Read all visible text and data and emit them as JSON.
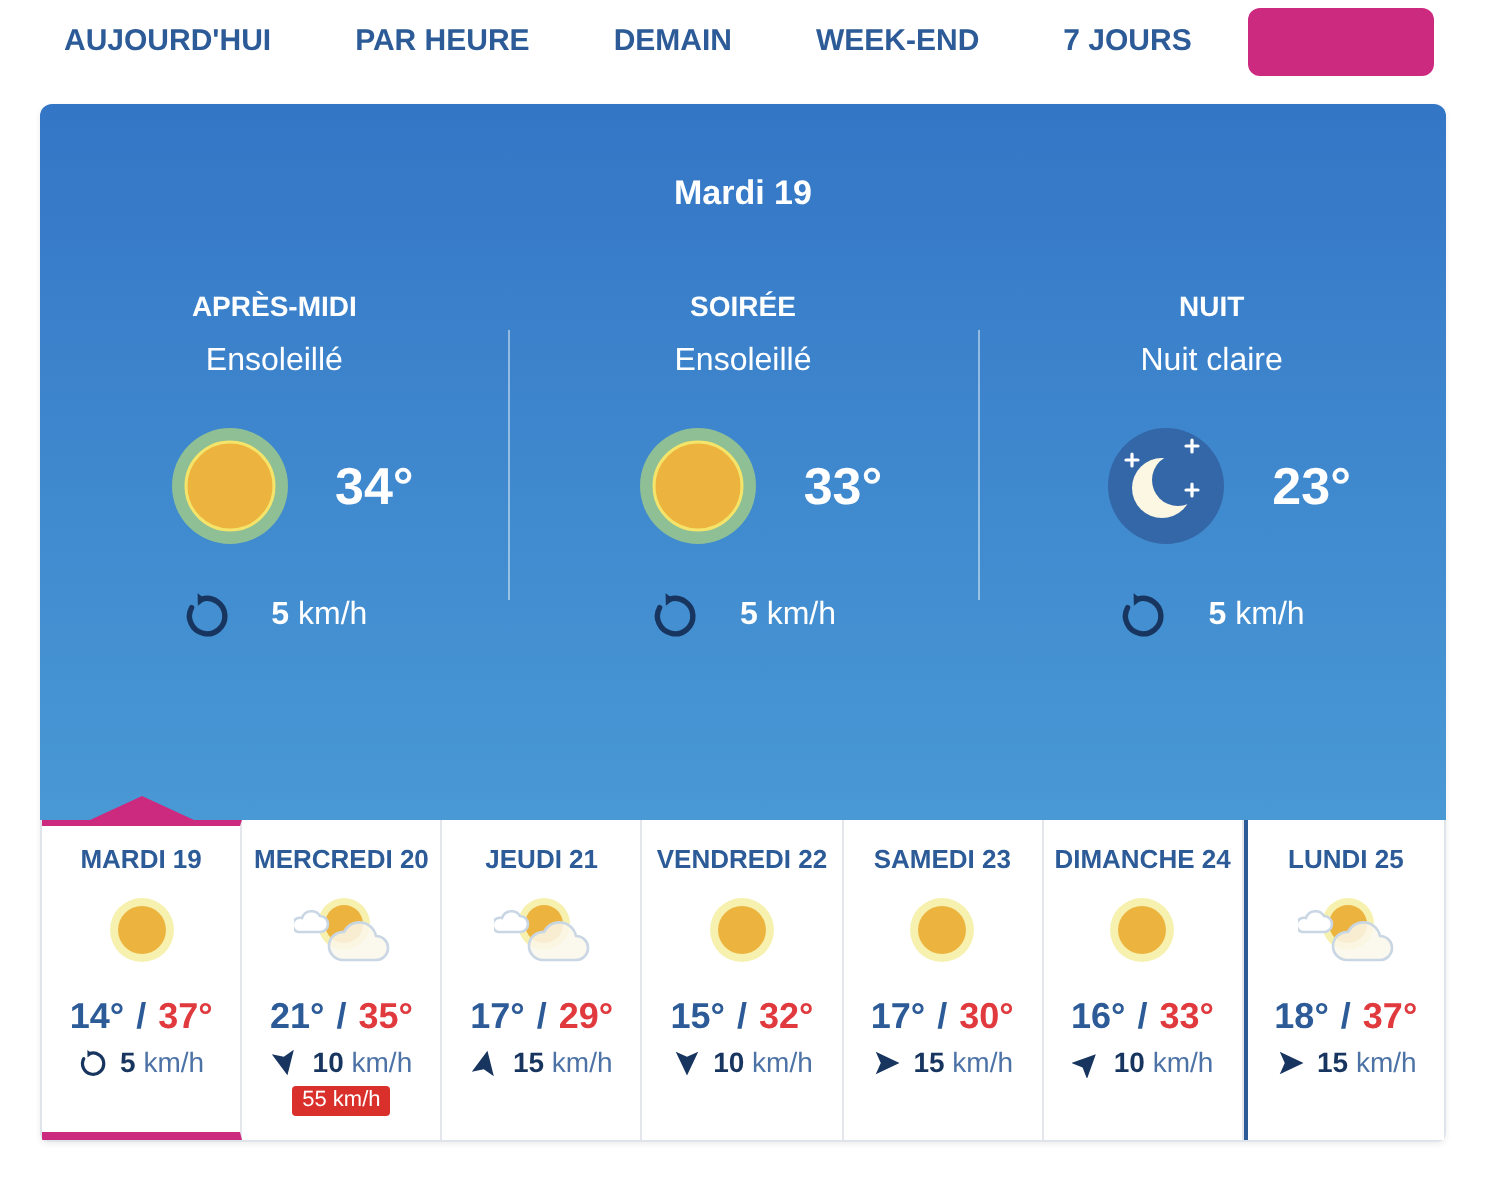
{
  "nav": {
    "tabs": [
      {
        "label": "AUJOURD'HUI"
      },
      {
        "label": "PAR HEURE"
      },
      {
        "label": "DEMAIN"
      },
      {
        "label": "WEEK-END"
      },
      {
        "label": "7 JOURS"
      }
    ]
  },
  "forecast": {
    "title": "Mardi 19",
    "periods": [
      {
        "name": "APRÈS-MIDI",
        "condition": "Ensoleillé",
        "kind": "sun",
        "temperature": "34°",
        "wind": {
          "kind": "variable",
          "text": "**5** km/h"
        }
      },
      {
        "name": "SOIRÉE",
        "condition": "Ensoleillé",
        "kind": "sun",
        "temperature": "33°",
        "wind": {
          "kind": "variable",
          "text": "**5** km/h"
        }
      },
      {
        "name": "NUIT",
        "condition": "Nuit claire",
        "kind": "moon",
        "temperature": "23°",
        "wind": {
          "kind": "variable",
          "text": "**5** km/h"
        }
      }
    ]
  },
  "days": [
    {
      "label": "MARDI 19",
      "selected": true,
      "week_boundary": false,
      "kind": "sun",
      "min": "14°",
      "separator": "/",
      "max": "37°",
      "wind": {
        "kind": "variable",
        "text": "**5** km/h"
      }
    },
    {
      "label": "MERCREDI 20",
      "selected": false,
      "week_boundary": false,
      "kind": "suncloud",
      "min": "21°",
      "separator": "/",
      "max": "35°",
      "wind": {
        "kind": "sbe",
        "text": "**10** km/h"
      },
      "gust": "55 km/h"
    },
    {
      "label": "JEUDI 21",
      "selected": false,
      "week_boundary": false,
      "kind": "suncloud",
      "min": "17°",
      "separator": "/",
      "max": "29°",
      "wind": {
        "kind": "nbe",
        "text": "**15** km/h"
      }
    },
    {
      "label": "VENDREDI 22",
      "selected": false,
      "week_boundary": false,
      "kind": "sun",
      "min": "15°",
      "separator": "/",
      "max": "32°",
      "wind": {
        "kind": "s",
        "text": "**10** km/h"
      }
    },
    {
      "label": "SAMEDI 23",
      "selected": false,
      "week_boundary": false,
      "kind": "sun",
      "min": "17°",
      "separator": "/",
      "max": "30°",
      "wind": {
        "kind": "e",
        "text": "**15** km/h"
      }
    },
    {
      "label": "DIMANCHE 24",
      "selected": false,
      "week_boundary": false,
      "kind": "sun",
      "min": "16°",
      "separator": "/",
      "max": "33°",
      "wind": {
        "kind": "ne",
        "text": "**10** km/h"
      }
    },
    {
      "label": "LUNDI 25",
      "selected": false,
      "week_boundary": true,
      "kind": "suncloud",
      "min": "18°",
      "separator": "/",
      "max": "37°",
      "wind": {
        "kind": "e",
        "text": "**15** km/h"
      }
    }
  ]
}
